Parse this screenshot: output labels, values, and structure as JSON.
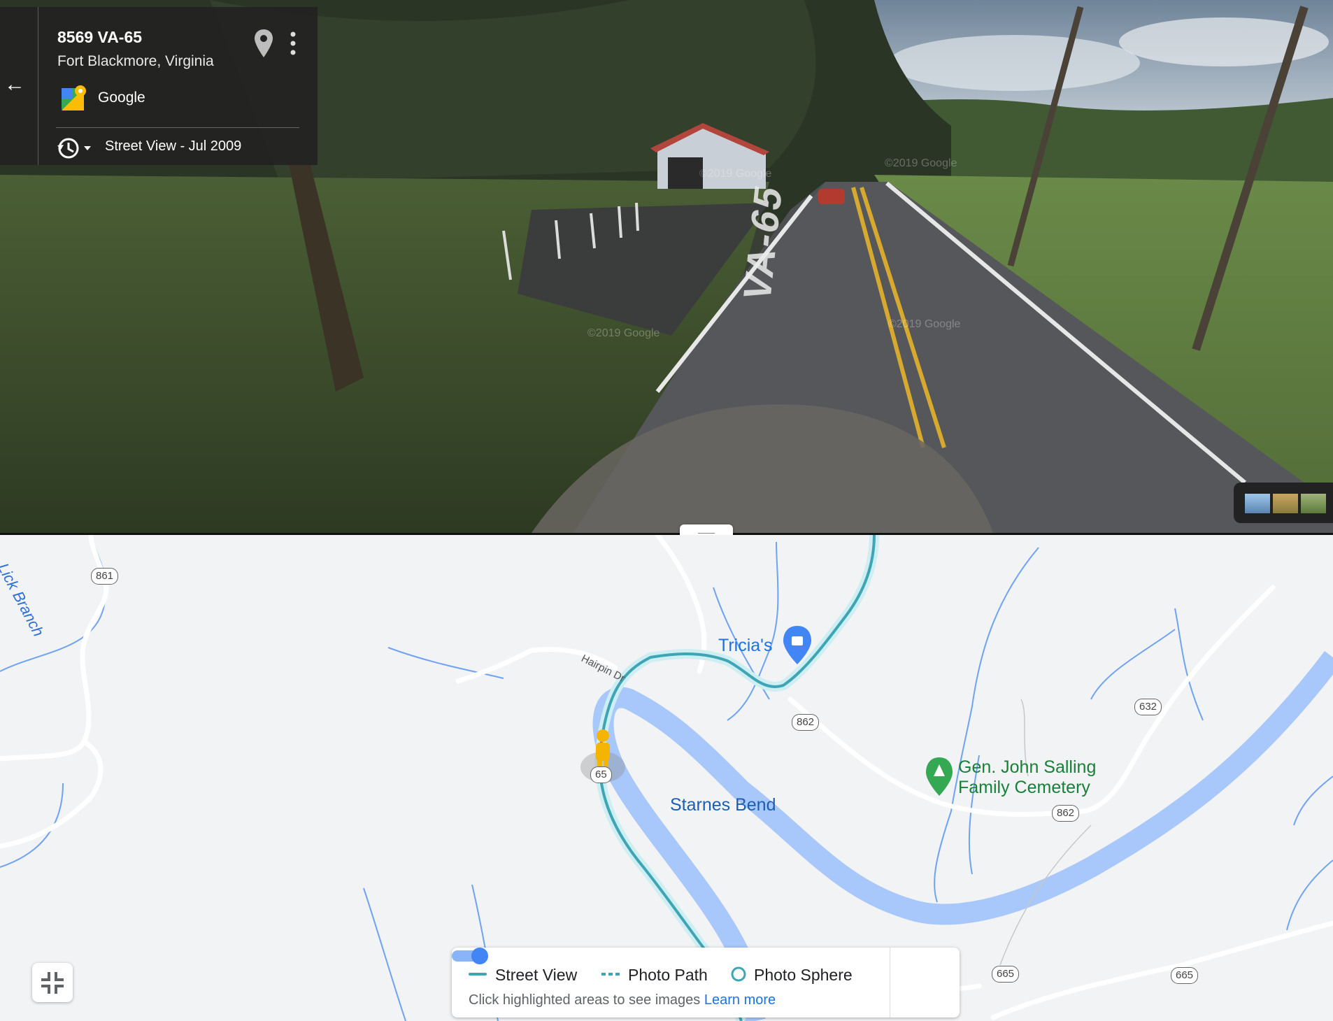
{
  "info_card": {
    "address": "8569 VA-65",
    "city": "Fort Blackmore, Virginia",
    "provider": "Google",
    "imagery_date": "Street View - Jul 2009",
    "icons": [
      "back-arrow-icon",
      "location-pin-icon",
      "more-vert-icon",
      "google-maps-logo",
      "history-icon",
      "dropdown-arrow-icon"
    ]
  },
  "street_view": {
    "road_marking": "VA-65",
    "watermark": "©2019 Google"
  },
  "map": {
    "water_labels": [
      "Lick Branch"
    ],
    "road_names": [
      "Hairpin Dr"
    ],
    "route_shields": [
      "861",
      "862",
      "862",
      "632",
      "65",
      "665",
      "665"
    ],
    "places": {
      "shop": "Tricia's",
      "area": "Starnes Bend",
      "cemetery": "Gen. John Salling Family Cemetery"
    }
  },
  "legend": {
    "street_view": "Street View",
    "photo_path": "Photo Path",
    "photo_sphere": "Photo Sphere",
    "hint": "Click highlighted areas to see images",
    "learn_more": "Learn more",
    "toggle_on": true
  },
  "colors": {
    "sv_line": "#3fa4b4",
    "river": "#a8c7fa",
    "stream": "#6fa3f2",
    "pegman": "#f4b400",
    "accent": "#1a73e8"
  }
}
